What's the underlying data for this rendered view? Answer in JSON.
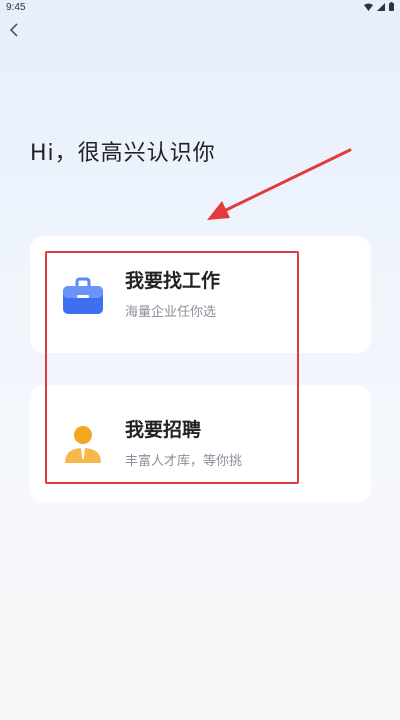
{
  "status_bar": {
    "time": "9:45"
  },
  "greeting": "Hi，很高兴认识你",
  "options": [
    {
      "title": "我要找工作",
      "subtitle": "海量企业任你选",
      "icon": "briefcase-icon"
    },
    {
      "title": "我要招聘",
      "subtitle": "丰富人才库，等你挑",
      "icon": "person-icon"
    }
  ],
  "colors": {
    "highlight": "#e23b3b",
    "briefcase": "#3d6ff0",
    "person": "#f5a623"
  }
}
